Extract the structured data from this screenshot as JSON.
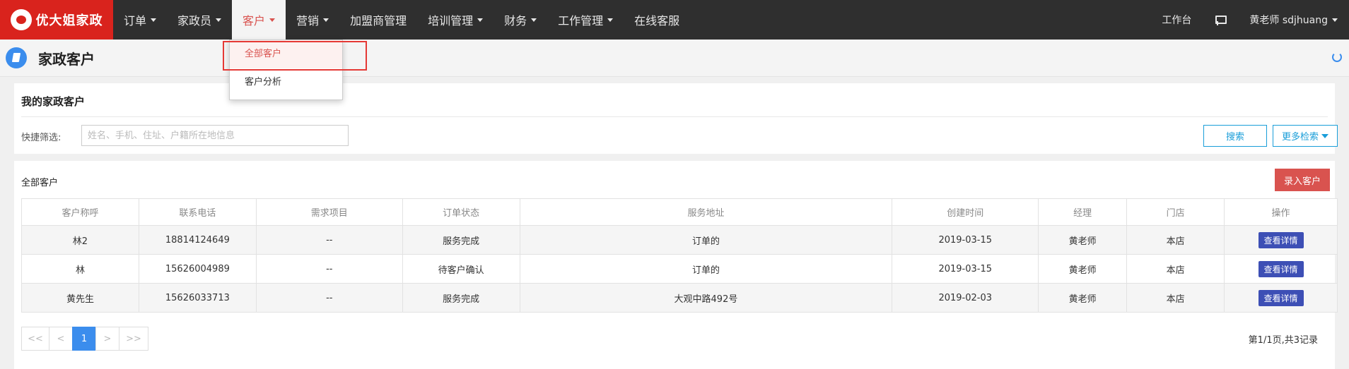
{
  "brand": {
    "logo_text": "优大姐家政",
    "accent": "#d9231d"
  },
  "nav": {
    "items": [
      {
        "label": "订单",
        "has_caret": true
      },
      {
        "label": "家政员",
        "has_caret": true
      },
      {
        "label": "客户",
        "has_caret": true,
        "active": true
      },
      {
        "label": "营销",
        "has_caret": true
      },
      {
        "label": "加盟商管理",
        "has_caret": false
      },
      {
        "label": "培训管理",
        "has_caret": true
      },
      {
        "label": "财务",
        "has_caret": true
      },
      {
        "label": "工作管理",
        "has_caret": true
      },
      {
        "label": "在线客服",
        "has_caret": false
      }
    ],
    "workbench": "工作台",
    "user": "黄老师 sdjhuang"
  },
  "dropdown": {
    "items": [
      "全部客户",
      "客户分析"
    ],
    "selected_index": 0
  },
  "page": {
    "title": "家政客户"
  },
  "filter": {
    "title": "我的家政客户",
    "label": "快捷筛选:",
    "placeholder": "姓名、手机、住址、户籍所在地信息",
    "value": "",
    "search_label": "搜索",
    "more_label": "更多检索"
  },
  "list": {
    "title": "全部客户",
    "add_label": "录入客户",
    "columns": [
      "客户称呼",
      "联系电话",
      "需求项目",
      "订单状态",
      "服务地址",
      "创建时间",
      "经理",
      "门店",
      "操作"
    ],
    "rows": [
      [
        "林2",
        "18814124649",
        "--",
        "服务完成",
        "订单的",
        "2019-03-15",
        "黄老师",
        "本店",
        "查看详情"
      ],
      [
        "林",
        "15626004989",
        "--",
        "待客户确认",
        "订单的",
        "2019-03-15",
        "黄老师",
        "本店",
        "查看详情"
      ],
      [
        "黄先生",
        "15626033713",
        "--",
        "服务完成",
        "大观中路492号",
        "2019-02-03",
        "黄老师",
        "本店",
        "查看详情"
      ]
    ]
  },
  "pager": {
    "first": "<<",
    "prev": "<",
    "current": "1",
    "next": ">",
    "last": ">>",
    "info": "第1/1页,共3记录"
  }
}
